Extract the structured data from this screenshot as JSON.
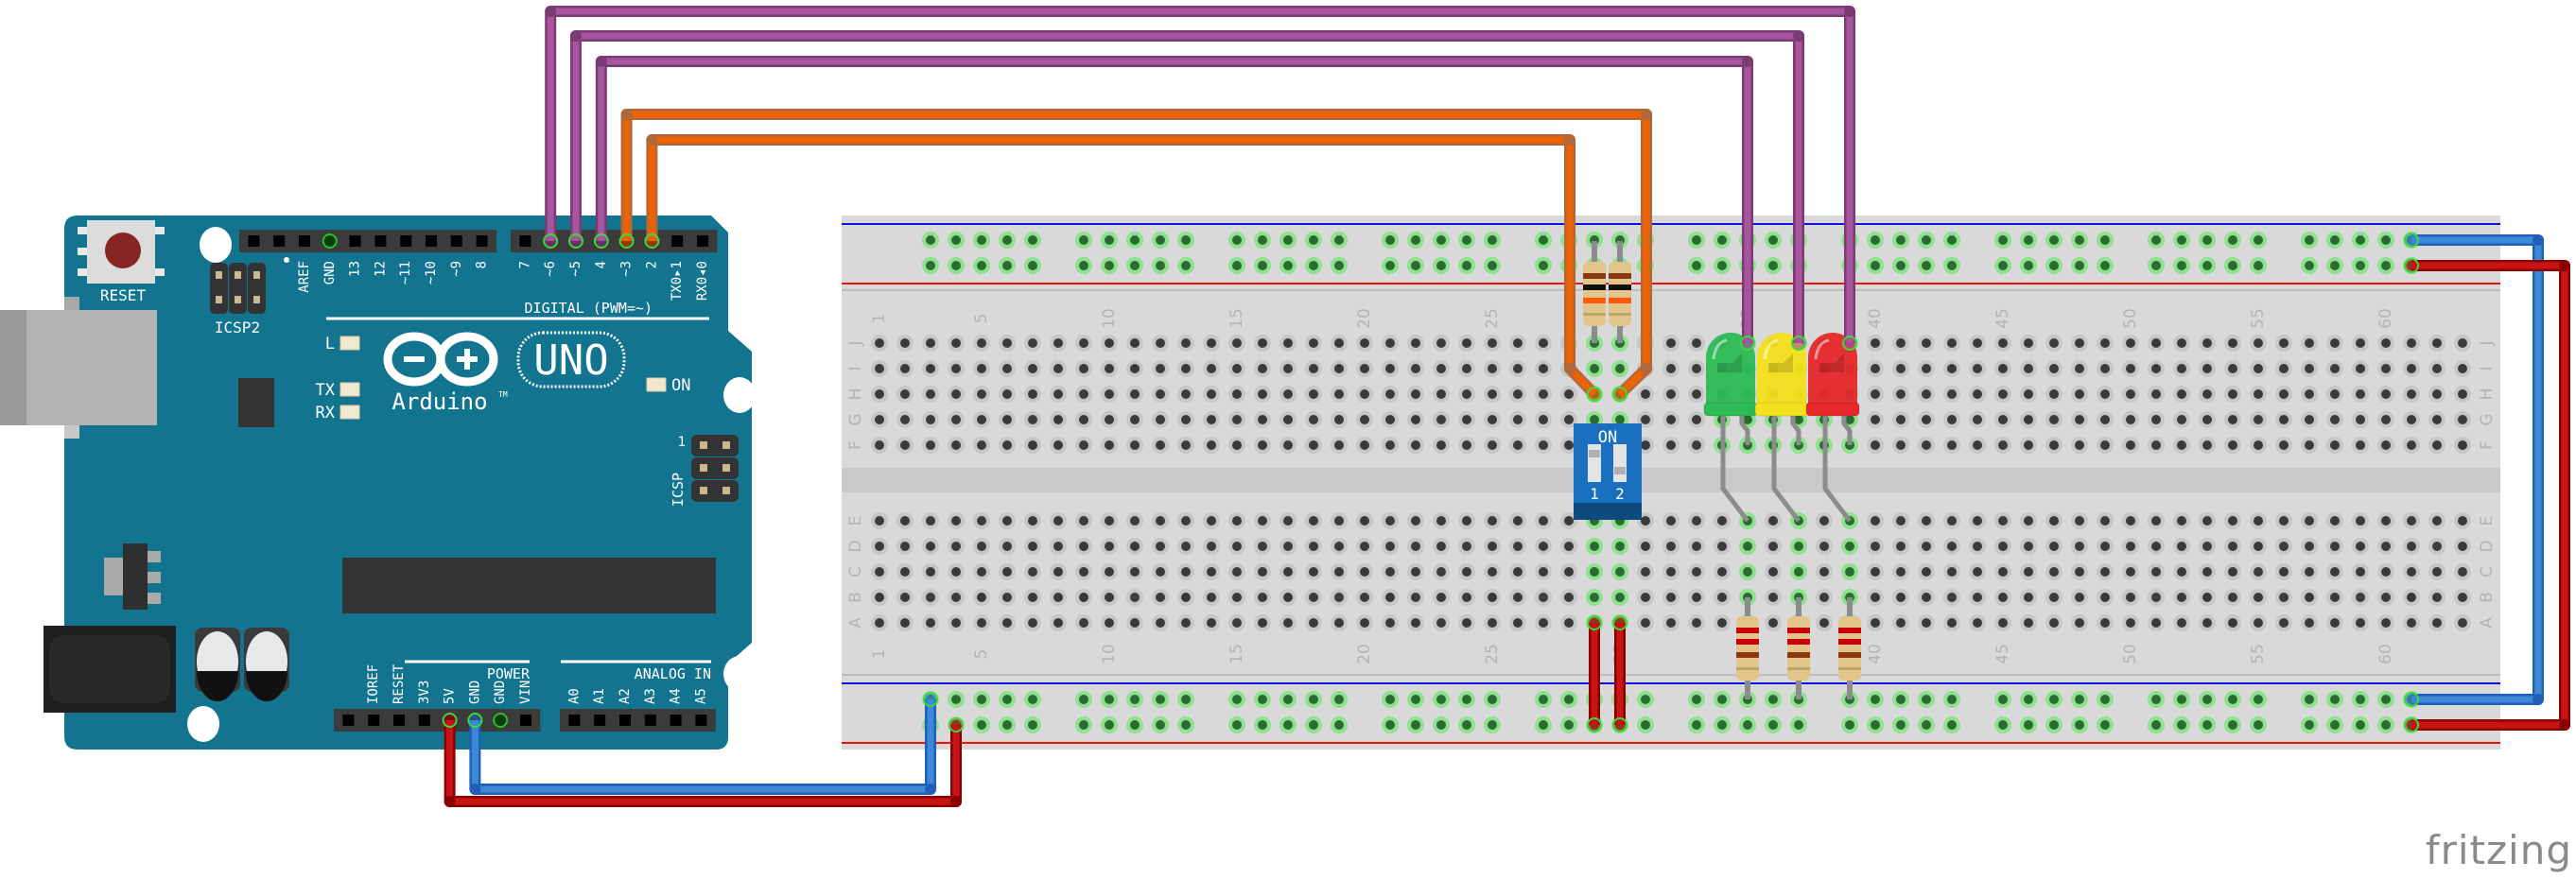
{
  "title": "Arduino UNO with DIP switch and three LEDs (Fritzing breadboard view)",
  "logo": "fritzing",
  "colors": {
    "arduino_board": "#137490",
    "breadboard": "#d9d9d9",
    "wire_purple": "#a855a0",
    "wire_orange": "#ec6306",
    "wire_red": "#c81414",
    "wire_blue": "#3d89d8",
    "led_green": "#2dbb55",
    "led_yellow": "#f4e01c",
    "led_red": "#e6282a",
    "dip_switch": "#1a6fbe"
  },
  "arduino": {
    "model_text": "UNO",
    "brand_text": "Arduino",
    "tm": "TM",
    "reset_label": "RESET",
    "icsp2_label": "ICSP2",
    "icsp_label": "ICSP",
    "icsp_pin1": "1",
    "digital_label": "DIGITAL (PWM=~)",
    "power_label": "POWER",
    "analog_label": "ANALOG IN",
    "led_labels": {
      "l": "L",
      "tx": "TX",
      "rx": "RX",
      "on": "ON"
    },
    "header_left_pins": [
      "",
      "",
      "AREF",
      "GND",
      "13",
      "12",
      "~11",
      "~10",
      "~9",
      "8"
    ],
    "header_right_pins": [
      "7",
      "~6",
      "~5",
      "4",
      "~3",
      "2",
      "TX0▸1",
      "RX0◂0"
    ],
    "power_pins": [
      "",
      "IOREF",
      "RESET",
      "3V3",
      "5V",
      "GND",
      "GND",
      "VIN"
    ],
    "analog_pins": [
      "A0",
      "A1",
      "A2",
      "A3",
      "A4",
      "A5"
    ]
  },
  "breadboard": {
    "columns": 63,
    "top_rows": [
      "J",
      "I",
      "H",
      "G",
      "F"
    ],
    "bottom_rows": [
      "E",
      "D",
      "C",
      "B",
      "A"
    ],
    "column_labels": [
      "1",
      "5",
      "10",
      "15",
      "20",
      "25",
      "30",
      "35",
      "40",
      "45",
      "50",
      "55",
      "60"
    ]
  },
  "components": {
    "resistors_top": [
      {
        "id": "R1",
        "bands": [
          "brown",
          "black",
          "orange",
          "gold"
        ],
        "column": 29
      },
      {
        "id": "R2",
        "bands": [
          "brown",
          "black",
          "orange",
          "gold"
        ],
        "column": 30
      }
    ],
    "resistors_bottom": [
      {
        "id": "R3",
        "bands": [
          "red",
          "red",
          "brown",
          "gold"
        ],
        "column": 35
      },
      {
        "id": "R4",
        "bands": [
          "red",
          "red",
          "brown",
          "gold"
        ],
        "column": 37
      },
      {
        "id": "R5",
        "bands": [
          "red",
          "red",
          "brown",
          "gold"
        ],
        "column": 39
      }
    ],
    "leds": [
      {
        "id": "LED1",
        "color": "green",
        "anode_column": 35
      },
      {
        "id": "LED2",
        "color": "yellow",
        "anode_column": 37
      },
      {
        "id": "LED3",
        "color": "red",
        "anode_column": 39
      }
    ],
    "dip_switch": {
      "label_on": "ON",
      "switch_labels": [
        "1",
        "2"
      ],
      "columns": [
        29,
        30
      ]
    }
  },
  "wires": [
    {
      "color": "purple",
      "from": "Arduino D6",
      "to": "breadboard J39 (red LED)"
    },
    {
      "color": "purple",
      "from": "Arduino D5",
      "to": "breadboard J37 (yellow LED)"
    },
    {
      "color": "purple",
      "from": "Arduino D4",
      "to": "breadboard J35 (green LED)"
    },
    {
      "color": "orange",
      "from": "Arduino D3",
      "to": "breadboard H30"
    },
    {
      "color": "orange",
      "from": "Arduino D2",
      "to": "breadboard H29"
    },
    {
      "color": "red",
      "from": "Arduino 5V",
      "to": "bottom + rail"
    },
    {
      "color": "blue",
      "from": "Arduino GND",
      "to": "bottom - rail"
    },
    {
      "color": "blue",
      "from": "top - rail",
      "to": "bottom - rail"
    },
    {
      "color": "red",
      "from": "top + rail",
      "to": "bottom + rail"
    },
    {
      "color": "red",
      "from": "bottom + rail col 29",
      "to": "A29"
    },
    {
      "color": "red",
      "from": "bottom + rail col 30",
      "to": "A30"
    }
  ]
}
